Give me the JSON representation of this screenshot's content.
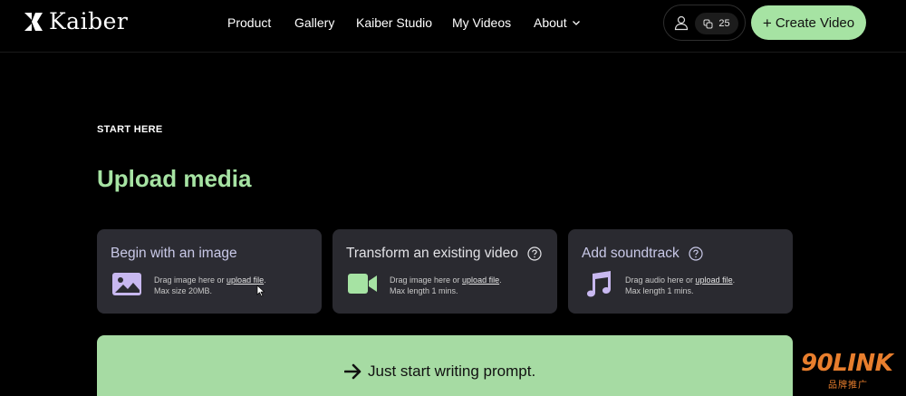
{
  "header": {
    "brand": "Kaiber",
    "nav": [
      {
        "label": "Product"
      },
      {
        "label": "Gallery"
      },
      {
        "label": "Kaiber Studio"
      },
      {
        "label": "My Videos"
      },
      {
        "label": "About"
      }
    ],
    "credits": "25",
    "create_label": "Create Video"
  },
  "main": {
    "eyebrow": "START HERE",
    "title": "Upload media",
    "cards": [
      {
        "title": "Begin with an image",
        "desc_prefix": "Drag image here or ",
        "desc_link": "upload file",
        "desc_suffix": ".",
        "desc_line2": "Max size 20MB."
      },
      {
        "title": "Transform an existing video",
        "desc_prefix": "Drag image here or ",
        "desc_link": "upload file",
        "desc_suffix": ".",
        "desc_line2": "Max length 1 mins."
      },
      {
        "title": "Add soundtrack",
        "desc_prefix": "Drag audio here or ",
        "desc_link": "upload file",
        "desc_suffix": ".",
        "desc_line2": "Max length 1 mins."
      }
    ],
    "prompt_label": "Just start writing prompt."
  },
  "watermark": {
    "main": "90LINK",
    "sub": "品牌推广"
  },
  "colors": {
    "accent": "#a6e3a3",
    "background": "#000000",
    "card": "#2a2a30",
    "card_icon": "#c8b8f0",
    "video_icon": "#a6e3a3"
  }
}
